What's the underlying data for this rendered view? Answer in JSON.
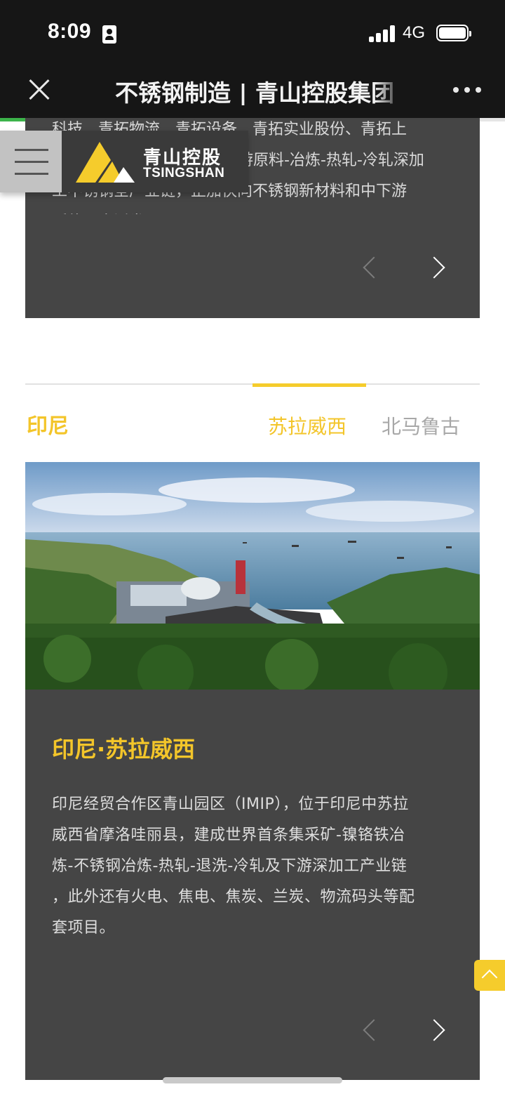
{
  "status_bar": {
    "time": "8:09",
    "network": "4G"
  },
  "browser": {
    "page_title": "不锈钢制造 | 青山控股集团",
    "load_progress_fraction": 0.92
  },
  "header": {
    "logo_cn": "青山控股",
    "logo_en": "TSINGSHAN",
    "logo_colors": [
      "#f5cc2c",
      "#ffffff"
    ]
  },
  "top_card": {
    "text_lines": [
      "科技、青拓物流、青拓设备、青拓实业股份、青拓上",
      "游原料-冶炼-热轧-冷轧深加",
      "工不锈钢全产业链，正加快向不锈钢新材料和中下游",
      "延伸，广泛发展。"
    ]
  },
  "region": {
    "title": "印尼",
    "tabs": [
      {
        "label": "苏拉威西",
        "active": true
      },
      {
        "label": "北马鲁古",
        "active": false
      }
    ]
  },
  "bottom_card": {
    "title": "印尼·苏拉威西",
    "body_lines": [
      "印尼经贸合作区青山园区（IMIP），位于印尼中苏拉",
      "威西省摩洛哇丽县，建成世界首条集采矿-镍铬铁冶",
      "炼-不锈钢冶炼-热轧-退洗-冷轧及下游深加工产业链",
      "，此外还有火电、焦电、焦炭、兰炭、物流码头等配",
      "套项目。"
    ]
  },
  "colors": {
    "accent": "#f3c52a",
    "card_bg": "#454545",
    "progress": "#3cb34a",
    "topbar": "#161616"
  },
  "icons": [
    "person-id-icon",
    "signal-icon",
    "battery-icon",
    "close-icon",
    "more-icon",
    "menu-icon",
    "prev-arrow-icon",
    "next-arrow-icon",
    "scroll-top-icon"
  ]
}
